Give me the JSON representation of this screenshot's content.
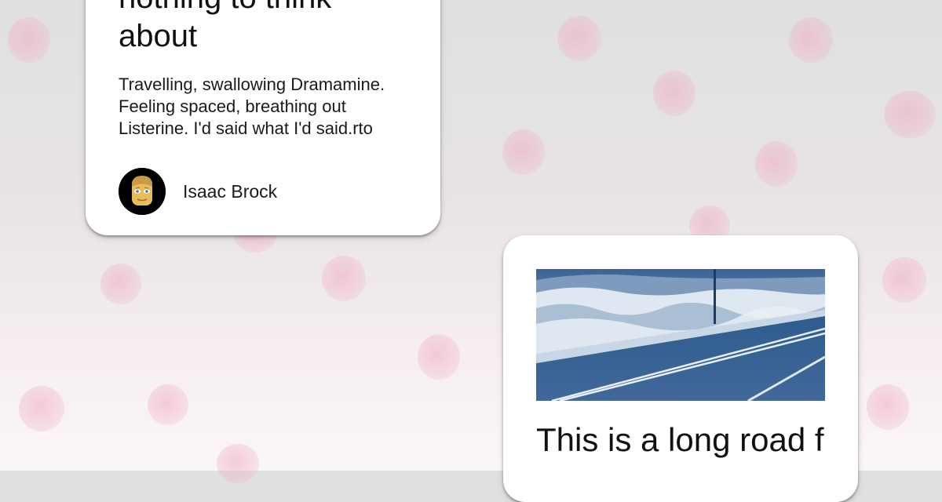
{
  "cards": [
    {
      "title": "nothing to think about",
      "body": "Travelling, swallowing Dramamine. Feeling spaced, breathing out Listerine. I'd said what I'd said.rto",
      "author": {
        "name": "Isaac Brock",
        "avatar_icon": "person-avatar-icon"
      }
    },
    {
      "image_icon": "road-photo",
      "title": "This is a long road f"
    }
  ],
  "colors": {
    "card_background": "#ffffff",
    "background_top": "#e0e0e0",
    "background_bottom": "#fbf6f7",
    "dot_pink": "#f0aabe",
    "photo_tint": "#1f4e85"
  }
}
